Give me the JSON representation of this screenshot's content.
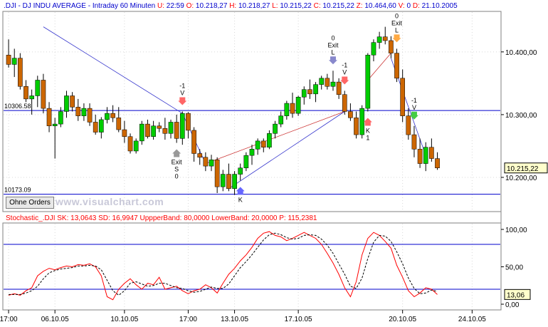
{
  "header": {
    "symbol": ".DJI - DJ INDU AVERAGE - Intraday 60 Minuten",
    "fields": [
      {
        "label": "U:",
        "value": "22:59"
      },
      {
        "label": "O:",
        "value": "10.218,27"
      },
      {
        "label": "H:",
        "value": "10.218,27"
      },
      {
        "label": "L:",
        "value": "10.215,22"
      },
      {
        "label": "C:",
        "value": "10.215,22"
      },
      {
        "label": "Z:",
        "value": "10.464,60"
      },
      {
        "label": "V:",
        "value": "0"
      },
      {
        "label": "D:",
        "value": "21.10.2005"
      }
    ]
  },
  "stochastic_header": {
    "name": "Stochastic_.DJI",
    "fields": [
      {
        "label": "SK:",
        "value": "13,0643"
      },
      {
        "label": "SD:",
        "value": "16,9947"
      },
      {
        "label": "UppperBand:",
        "value": "80,0000"
      },
      {
        "label": "LowerBand:",
        "value": "20,0000"
      },
      {
        "label": "P:",
        "value": "115,2381"
      }
    ]
  },
  "orders_button": "Ohne Orders",
  "watermark": "www.visualchart.com",
  "price_tags": {
    "current": "10.215,22",
    "stoch_current": "13,06"
  },
  "level_labels": {
    "upper": "10306.58",
    "lower": "10173.09"
  },
  "colors": {
    "up": "#00cc00",
    "down": "#cc6600",
    "band": "#0000cc",
    "sk": "#ff0000",
    "sd": "#000000",
    "tag_bg": "#ffffcc"
  },
  "annotations": [
    {
      "lines": [
        "-1",
        "V"
      ],
      "bar": 30,
      "arrow": "down-red"
    },
    {
      "lines": [
        "Exit",
        "S",
        "0"
      ],
      "bar": 29,
      "arrow": "up-gray"
    },
    {
      "lines": [
        "K"
      ],
      "bar": 40,
      "arrow": "up-blue"
    },
    {
      "lines": [
        "0",
        "Exit",
        "L"
      ],
      "bar": 56,
      "arrow": "down-gray"
    },
    {
      "lines": [
        "-1",
        "V"
      ],
      "bar": 58,
      "arrow": "down-red"
    },
    {
      "lines": [
        "K",
        "1"
      ],
      "bar": 62,
      "arrow": "up-red"
    },
    {
      "lines": [
        "0",
        "Exit",
        "L"
      ],
      "bar": 67,
      "arrow": "down-orange"
    },
    {
      "lines": [
        "-1",
        "V"
      ],
      "bar": 70,
      "arrow": "down-green"
    }
  ],
  "chart_data": [
    {
      "type": "candlestick",
      "title": ".DJI - DJ INDU AVERAGE - Intraday 60 Minuten",
      "ylim": [
        10150,
        10460
      ],
      "yticks": [
        "10.400,00",
        "10.300,00",
        "10.200,00"
      ],
      "ytick_values": [
        10400,
        10300,
        10200
      ],
      "xticks": [
        "17:00",
        "06.10.05",
        "10.10.05",
        "17:00",
        "13.10.05",
        "17.10.05",
        "20.10.05",
        "24.10.05"
      ],
      "xtick_bars": [
        0,
        8,
        20,
        31,
        39,
        50,
        68,
        80
      ],
      "horizontal_levels": [
        10306.58,
        10173.09
      ],
      "ohlc": [
        [
          10395,
          10420,
          10375,
          10380
        ],
        [
          10380,
          10405,
          10360,
          10390
        ],
        [
          10390,
          10398,
          10340,
          10345
        ],
        [
          10345,
          10355,
          10320,
          10325
        ],
        [
          10325,
          10340,
          10300,
          10330
        ],
        [
          10330,
          10362,
          10312,
          10355
        ],
        [
          10355,
          10365,
          10302,
          10310
        ],
        [
          10310,
          10320,
          10272,
          10282
        ],
        [
          10282,
          10295,
          10230,
          10285
        ],
        [
          10285,
          10312,
          10280,
          10305
        ],
        [
          10305,
          10338,
          10295,
          10330
        ],
        [
          10330,
          10336,
          10305,
          10312
        ],
        [
          10312,
          10325,
          10290,
          10298
        ],
        [
          10298,
          10318,
          10290,
          10310
        ],
        [
          10310,
          10318,
          10282,
          10288
        ],
        [
          10288,
          10300,
          10268,
          10272
        ],
        [
          10272,
          10296,
          10262,
          10292
        ],
        [
          10292,
          10312,
          10286,
          10302
        ],
        [
          10302,
          10315,
          10288,
          10295
        ],
        [
          10295,
          10312,
          10272,
          10276
        ],
        [
          10276,
          10290,
          10255,
          10265
        ],
        [
          10265,
          10270,
          10238,
          10242
        ],
        [
          10242,
          10262,
          10238,
          10258
        ],
        [
          10258,
          10290,
          10252,
          10285
        ],
        [
          10285,
          10292,
          10262,
          10265
        ],
        [
          10265,
          10290,
          10260,
          10282
        ],
        [
          10282,
          10288,
          10272,
          10278
        ],
        [
          10278,
          10295,
          10260,
          10270
        ],
        [
          10270,
          10292,
          10262,
          10288
        ],
        [
          10288,
          10300,
          10255,
          10262
        ],
        [
          10262,
          10305,
          10252,
          10302
        ],
        [
          10302,
          10304,
          10262,
          10275
        ],
        [
          10275,
          10280,
          10225,
          10238
        ],
        [
          10238,
          10245,
          10220,
          10232
        ],
        [
          10232,
          10240,
          10210,
          10218
        ],
        [
          10218,
          10236,
          10210,
          10228
        ],
        [
          10228,
          10232,
          10175,
          10185
        ],
        [
          10185,
          10212,
          10178,
          10205
        ],
        [
          10205,
          10222,
          10178,
          10182
        ],
        [
          10182,
          10210,
          10172,
          10205
        ],
        [
          10205,
          10222,
          10195,
          10215
        ],
        [
          10215,
          10240,
          10210,
          10235
        ],
        [
          10235,
          10252,
          10220,
          10245
        ],
        [
          10245,
          10262,
          10236,
          10258
        ],
        [
          10258,
          10262,
          10240,
          10248
        ],
        [
          10248,
          10275,
          10245,
          10270
        ],
        [
          10270,
          10290,
          10262,
          10285
        ],
        [
          10285,
          10305,
          10280,
          10298
        ],
        [
          10298,
          10322,
          10292,
          10318
        ],
        [
          10318,
          10335,
          10295,
          10302
        ],
        [
          10302,
          10330,
          10298,
          10328
        ],
        [
          10328,
          10345,
          10316,
          10340
        ],
        [
          10340,
          10356,
          10325,
          10333
        ],
        [
          10333,
          10352,
          10320,
          10348
        ],
        [
          10348,
          10362,
          10340,
          10358
        ],
        [
          10358,
          10365,
          10340,
          10345
        ],
        [
          10345,
          10370,
          10338,
          10352
        ],
        [
          10352,
          10358,
          10325,
          10332
        ],
        [
          10332,
          10338,
          10300,
          10305
        ],
        [
          10305,
          10318,
          10290,
          10295
        ],
        [
          10295,
          10305,
          10262,
          10268
        ],
        [
          10268,
          10315,
          10262,
          10310
        ],
        [
          10310,
          10398,
          10305,
          10395
        ],
        [
          10395,
          10420,
          10385,
          10415
        ],
        [
          10415,
          10432,
          10405,
          10424
        ],
        [
          10424,
          10440,
          10412,
          10418
        ],
        [
          10418,
          10425,
          10390,
          10398
        ],
        [
          10398,
          10405,
          10352,
          10358
        ],
        [
          10358,
          10372,
          10288,
          10298
        ],
        [
          10298,
          10310,
          10260,
          10268
        ],
        [
          10268,
          10282,
          10232,
          10245
        ],
        [
          10245,
          10262,
          10215,
          10222
        ],
        [
          10222,
          10256,
          10210,
          10248
        ],
        [
          10248,
          10262,
          10225,
          10230
        ],
        [
          10230,
          10240,
          10212,
          10215
        ]
      ]
    },
    {
      "type": "line",
      "title": "Stochastic_.DJI",
      "ylim": [
        -8,
        108
      ],
      "yticks": [
        "100,00",
        "50,00",
        "0,00"
      ],
      "ytick_values": [
        100,
        50,
        0
      ],
      "bands": [
        80,
        20
      ],
      "series": [
        {
          "name": "SK",
          "values": [
            12,
            14,
            12,
            18,
            22,
            38,
            44,
            48,
            46,
            49,
            51,
            50,
            53,
            52,
            54,
            50,
            38,
            10,
            6,
            20,
            28,
            34,
            26,
            20,
            28,
            26,
            36,
            20,
            22,
            24,
            18,
            14,
            18,
            20,
            26,
            22,
            15,
            28,
            40,
            48,
            58,
            66,
            76,
            88,
            95,
            97,
            92,
            90,
            85,
            88,
            92,
            96,
            92,
            88,
            80,
            68,
            55,
            40,
            22,
            10,
            30,
            66,
            88,
            96,
            92,
            84,
            75,
            52,
            36,
            18,
            10,
            15,
            22,
            20,
            13
          ]
        },
        {
          "name": "SD",
          "values": [
            13,
            13,
            13,
            15,
            18,
            24,
            34,
            42,
            45,
            47,
            48,
            49,
            51,
            51,
            52,
            51,
            46,
            32,
            18,
            12,
            18,
            28,
            30,
            27,
            24,
            25,
            28,
            28,
            25,
            22,
            21,
            18,
            16,
            17,
            20,
            23,
            21,
            21,
            27,
            38,
            49,
            57,
            66,
            76,
            86,
            93,
            95,
            93,
            89,
            87,
            88,
            92,
            93,
            92,
            87,
            79,
            68,
            54,
            40,
            24,
            21,
            35,
            61,
            83,
            92,
            91,
            84,
            70,
            54,
            35,
            21,
            14,
            15,
            19,
            17
          ]
        }
      ]
    }
  ]
}
